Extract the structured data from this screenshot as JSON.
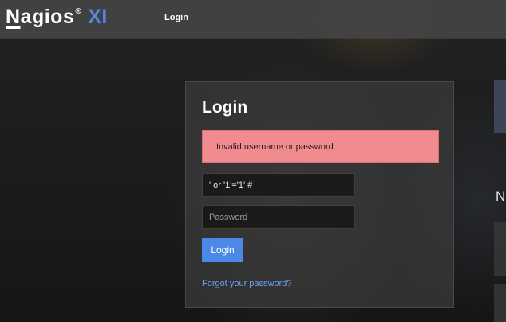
{
  "brand": {
    "name_first_letter": "N",
    "name_rest": "agios",
    "registered_mark": "®",
    "product_suffix": "XI"
  },
  "topnav": {
    "login_link": "Login"
  },
  "login_panel": {
    "title": "Login",
    "error_message": "Invalid username or password.",
    "username": {
      "value": "' or '1'='1' #"
    },
    "password": {
      "value": "",
      "placeholder": "Password"
    },
    "submit_label": "Login",
    "forgot_link": "Forgot your password?"
  },
  "right_column": {
    "partial_heading": "N"
  },
  "colors": {
    "accent": "#4c88e6",
    "error_bg": "#f08c8f",
    "link": "#6aa2f0"
  }
}
